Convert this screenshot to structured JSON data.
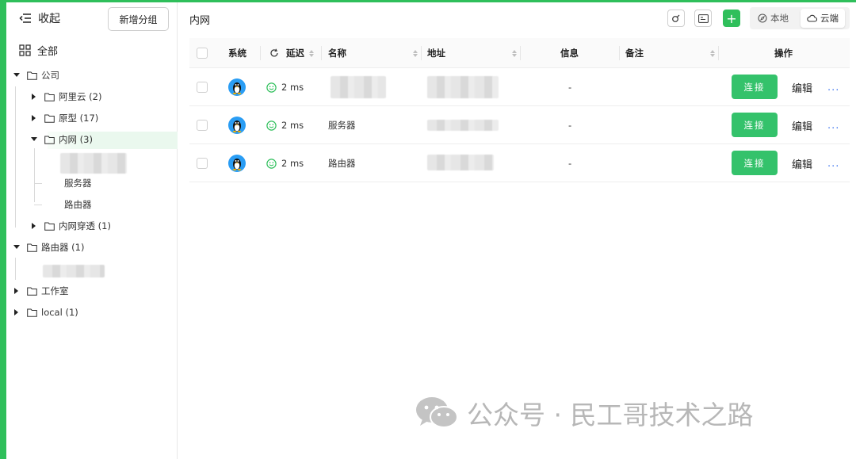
{
  "sidebar": {
    "collapse_label": "收起",
    "add_group_label": "新增分组",
    "all_label": "全部",
    "tree": [
      {
        "label": "公司",
        "expanded": true
      },
      {
        "label": "阿里云 (2)",
        "expanded": false
      },
      {
        "label": "原型 (17)",
        "expanded": false
      },
      {
        "label": "内网 (3)",
        "expanded": true,
        "selected": true
      },
      {
        "label": "服务器"
      },
      {
        "label": "路由器"
      },
      {
        "label": "内网穿透 (1)",
        "expanded": false
      },
      {
        "label": "路由器 (1)",
        "expanded": true
      },
      {
        "label": "工作室",
        "expanded": false
      },
      {
        "label": "local (1)",
        "expanded": false
      }
    ]
  },
  "main": {
    "title": "内网",
    "mode": {
      "local_label": "本地",
      "cloud_label": "云端",
      "active": "cloud"
    },
    "table": {
      "headers": {
        "system": "系统",
        "latency": "延迟",
        "name": "名称",
        "address": "地址",
        "info": "信息",
        "note": "备注",
        "actions": "操作"
      },
      "rows": [
        {
          "latency": "2 ms",
          "name": "",
          "info": "-",
          "connect": "连接",
          "edit": "编辑",
          "more": "..."
        },
        {
          "latency": "2 ms",
          "name": "服务器",
          "info": "-",
          "connect": "连接",
          "edit": "编辑",
          "more": "..."
        },
        {
          "latency": "2 ms",
          "name": "路由器",
          "info": "-",
          "connect": "连接",
          "edit": "编辑",
          "more": "..."
        }
      ]
    }
  },
  "watermark": "公众号 · 民工哥技术之路",
  "colors": {
    "accent": "#2fbf5b",
    "connect_button": "#34c26b",
    "latency_ok": "#2fbf5b",
    "link_blue": "#4a7df0"
  }
}
